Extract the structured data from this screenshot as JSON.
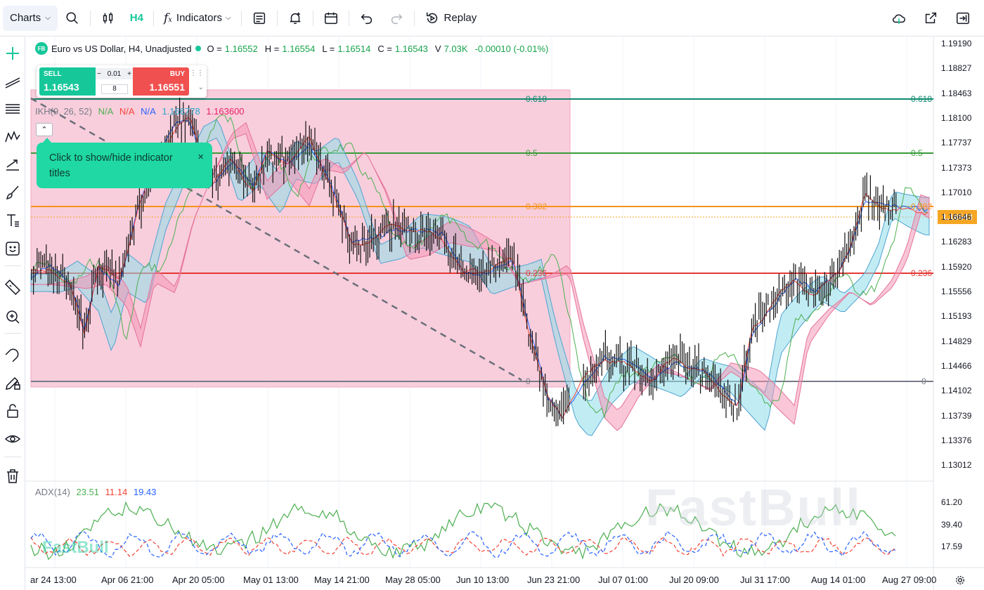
{
  "toolbar": {
    "charts_label": "Charts",
    "timeframe": "H4",
    "indicators_label": "Indicators",
    "replay_label": "Replay"
  },
  "legend": {
    "symbol_badge": "FB",
    "title": "Euro vs US Dollar, H4, Unadjusted",
    "open_key": "O =",
    "open": "1.16552",
    "high_key": "H =",
    "high": "1.16554",
    "low_key": "L =",
    "low": "1.16514",
    "close_key": "C =",
    "close": "1.16543",
    "volume_key": "V",
    "volume": "7.03K",
    "change": "-0.00010 (-0.01%)"
  },
  "trade": {
    "sell_label": "SELL",
    "sell_price": "1.16543",
    "buy_label": "BUY",
    "buy_price": "1.16551",
    "minus": "−",
    "lot_step": "0.01",
    "plus": "+",
    "lots": "8"
  },
  "ichimoku": {
    "name": "IKH(9, 26, 52)",
    "v1": "N/A",
    "v2": "N/A",
    "v3": "N/A",
    "v4": "1.166778",
    "v5": "1.163600"
  },
  "tooltip": {
    "text": "Click to show/hide indicator titles",
    "close": "×"
  },
  "price_axis": [
    "1.19190",
    "1.18827",
    "1.18463",
    "1.18100",
    "1.17737",
    "1.17373",
    "1.17010",
    "1.16646",
    "1.16283",
    "1.15920",
    "1.15556",
    "1.15193",
    "1.14829",
    "1.14466",
    "1.14102",
    "1.13739",
    "1.13376",
    "1.13012"
  ],
  "current_price": "1.16543",
  "fib_levels": [
    {
      "label": "0.618",
      "color": "#0f8a6e"
    },
    {
      "label": "0.5",
      "color": "#3a9c3a"
    },
    {
      "label": "0.382",
      "color": "#f7931a"
    },
    {
      "label": "0.236",
      "color": "#e53935"
    },
    {
      "label": "0",
      "color": "#787b86"
    }
  ],
  "adx": {
    "name": "ADX(14)",
    "adx": "23.51",
    "di_minus": "11.14",
    "di_plus": "19.43",
    "axis": [
      "61.20",
      "39.40",
      "17.59"
    ]
  },
  "time_axis": [
    "ar 24 13:00",
    "Apr 06 21:00",
    "Apr 20 05:00",
    "May 01 13:00",
    "May 14 21:00",
    "May 28 05:00",
    "Jun 10 13:00",
    "Jun 23 21:00",
    "Jul 07 01:00",
    "Jul 20 09:00",
    "Jul 31 17:00",
    "Aug 14 01:00",
    "Aug 27 09:00"
  ],
  "watermark": "FastBull",
  "colors": {
    "accent": "#16c79a",
    "sell": "#16c79a",
    "buy": "#f0504f",
    "fib_zone": "#f7c6d6",
    "cloud_bull": "#8fdcea",
    "cloud_bear": "#f48fb1",
    "price_marker": "#f5a623"
  }
}
